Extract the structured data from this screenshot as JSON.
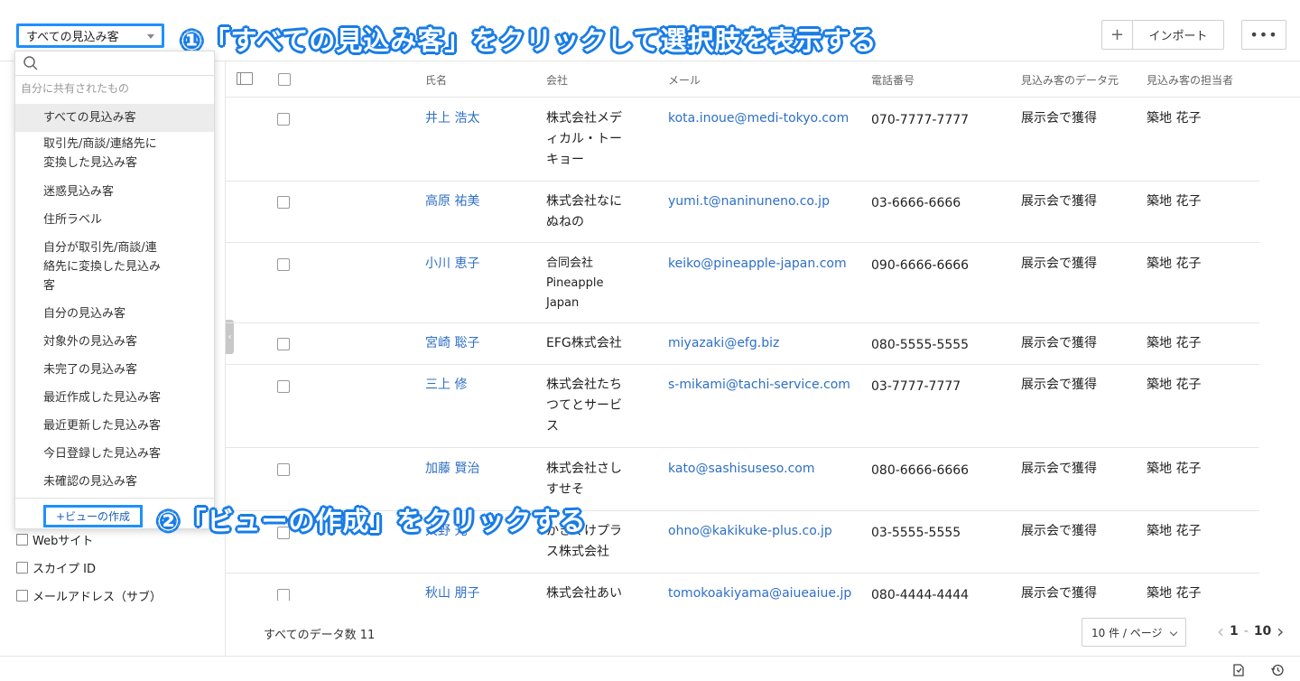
{
  "header": {
    "view_label": "すべての見込み客",
    "annotation_1": "①「すべての見込み客」をクリックして選択肢を表示する",
    "annotation_2": "②「ビューの作成」をクリックする",
    "plus_label": "+",
    "import_label": "インポート",
    "more_label": "•••"
  },
  "dropdown": {
    "group_label": "自分に共有されたもの",
    "items": [
      "すべての見込み客",
      "取引先/商談/連絡先に",
      "変換した見込み客",
      "迷惑見込み客",
      "住所ラベル",
      "自分が取引先/商談/連",
      "絡先に変換した見込み",
      "客",
      "自分の見込み客",
      "対象外の見込み客",
      "未完了の見込み客",
      "最近作成した見込み客",
      "最近更新した見込み客",
      "今日登録した見込み客",
      "未確認の見込み客"
    ],
    "create_view_label": "+ビューの作成"
  },
  "sidebar": {
    "filters": [
      "Webサイト",
      "スカイプ ID",
      "メールアドレス（サブ）"
    ]
  },
  "table": {
    "columns": [
      "氏名",
      "会社",
      "メール",
      "電話番号",
      "見込み客のデータ元",
      "見込み客の担当者"
    ],
    "rows": [
      {
        "name": "井上 浩太",
        "company": [
          "株式会社メデ",
          "ィカル・トー",
          "キョー"
        ],
        "email": "kota.inoue@medi-tokyo.com",
        "phone": "070-7777-7777",
        "source": "展示会で獲得",
        "owner": "築地 花子"
      },
      {
        "name": "高原 祐美",
        "company": [
          "株式会社なに",
          "ぬねの"
        ],
        "email": "yumi.t@naninuneno.co.jp",
        "phone": "03-6666-6666",
        "source": "展示会で獲得",
        "owner": "築地 花子"
      },
      {
        "name": "小川 恵子",
        "company": [
          "合同会社",
          "Pineapple",
          "Japan"
        ],
        "email": "keiko@pineapple-japan.com",
        "phone": "090-6666-6666",
        "source": "展示会で獲得",
        "owner": "築地 花子"
      },
      {
        "name": "宮崎 聡子",
        "company": [
          "EFG株式会社"
        ],
        "email": "miyazaki@efg.biz",
        "phone": "080-5555-5555",
        "source": "展示会で獲得",
        "owner": "築地 花子"
      },
      {
        "name": "三上 修",
        "company": [
          "株式会社たち",
          "つてとサービ",
          "ス"
        ],
        "email": "s-mikami@tachi-service.com",
        "phone": "03-7777-7777",
        "source": "展示会で獲得",
        "owner": "築地 花子"
      },
      {
        "name": "加藤 賢治",
        "company": [
          "株式会社さし",
          "すせそ"
        ],
        "email": "kato@sashisuseso.com",
        "phone": "080-6666-6666",
        "source": "展示会で獲得",
        "owner": "築地 花子"
      },
      {
        "name": "大野 光",
        "company": [
          "かきくけプラ",
          "ス株式会社"
        ],
        "email": "ohno@kakikuke-plus.co.jp",
        "phone": "03-5555-5555",
        "source": "展示会で獲得",
        "owner": "築地 花子"
      },
      {
        "name": "秋山 朋子",
        "company": [
          "株式会社あい"
        ],
        "email": "tomokoakiyama@aiueaiue.jp",
        "phone": "080-4444-4444",
        "source": "展示会で獲得",
        "owner": "築地 花子"
      }
    ]
  },
  "footer": {
    "total_label": "すべてのデータ数 11",
    "per_page_label": "10 件 / ページ",
    "page_start": "1",
    "page_sep": "-",
    "page_end": "10"
  }
}
